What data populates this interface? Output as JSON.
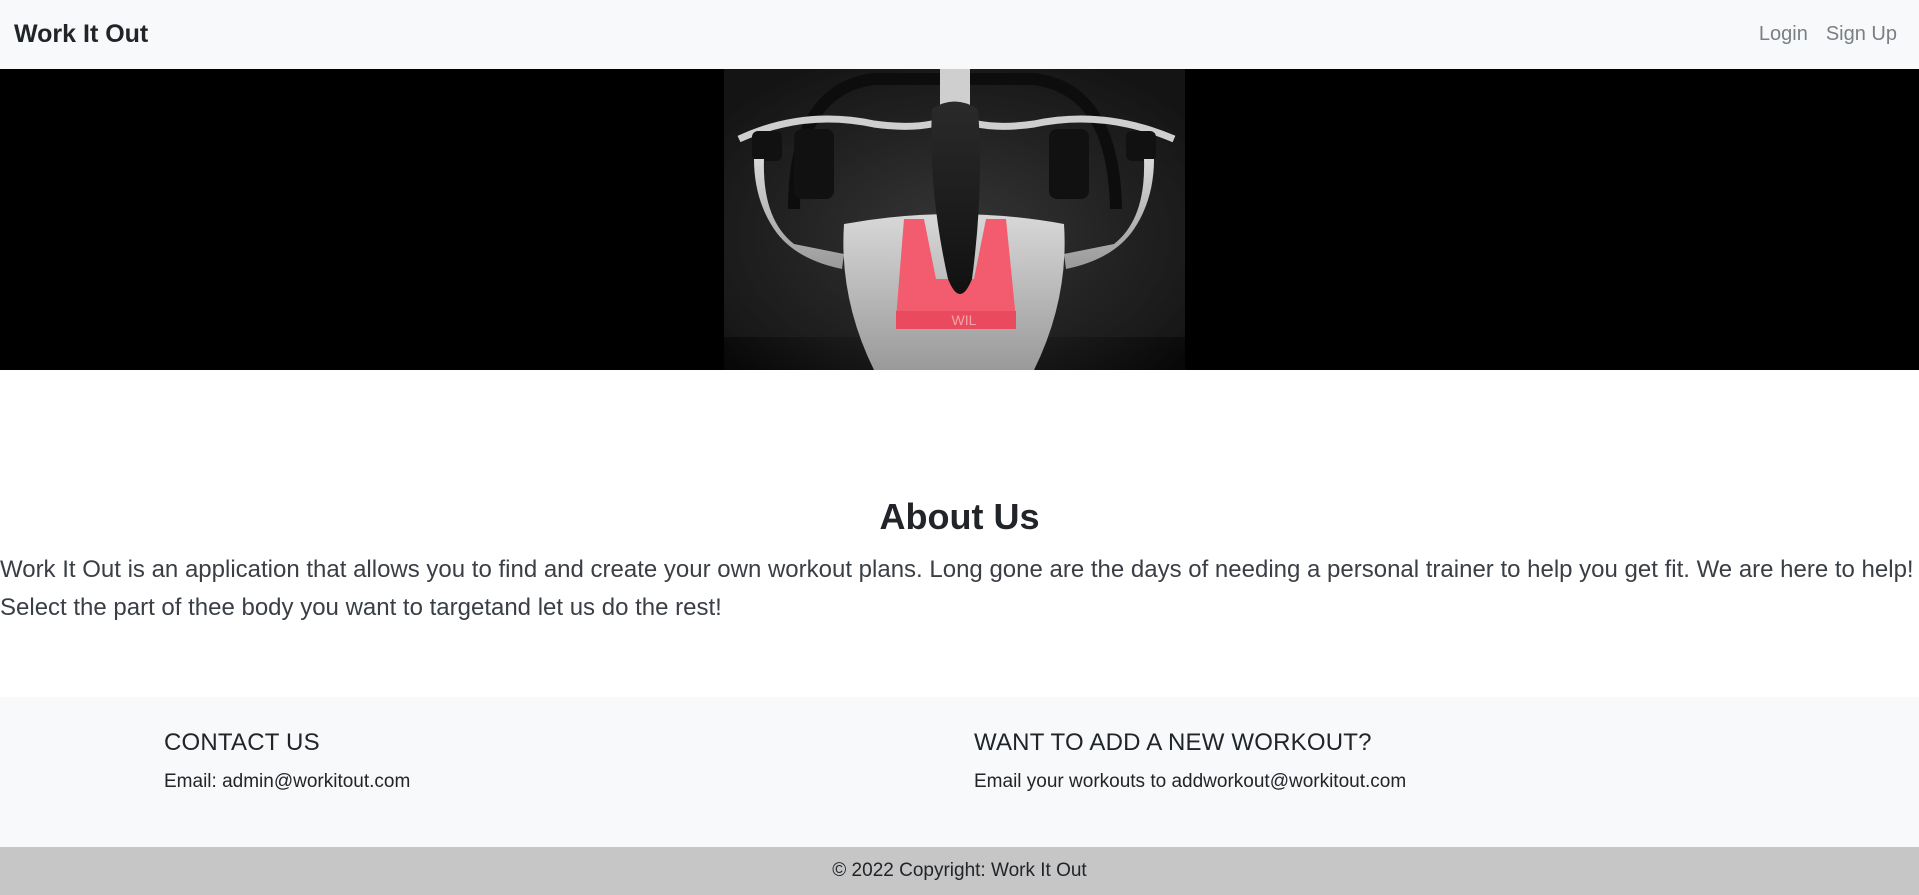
{
  "navbar": {
    "brand": "Work It Out",
    "links": [
      {
        "label": "Login"
      },
      {
        "label": "Sign Up"
      }
    ]
  },
  "hero": {
    "image": "woman-lat-pulldown-photo",
    "bra_text": "WIL"
  },
  "about": {
    "title": "About Us",
    "text": "Work It Out is an application that allows you to find and create your own workout plans. Long gone are the days of needing a personal trainer to help you get fit. We are here to help! Select the part of thee body you want to targetand let us do the rest!"
  },
  "contact": {
    "heading": "CONTACT US",
    "text": "Email: admin@workitout.com"
  },
  "add_workout": {
    "heading": "WANT TO ADD A NEW WORKOUT?",
    "text": "Email your workouts to addworkout@workitout.com"
  },
  "copyright": {
    "text": "© 2022 Copyright: Work It Out"
  },
  "colors": {
    "navbar_bg": "#f8f9fa",
    "hero_bg": "#000000",
    "footer_bg": "#f8f9fa",
    "copyright_bg": "#c6c6c6",
    "accent_pink": "#f25c6e"
  }
}
